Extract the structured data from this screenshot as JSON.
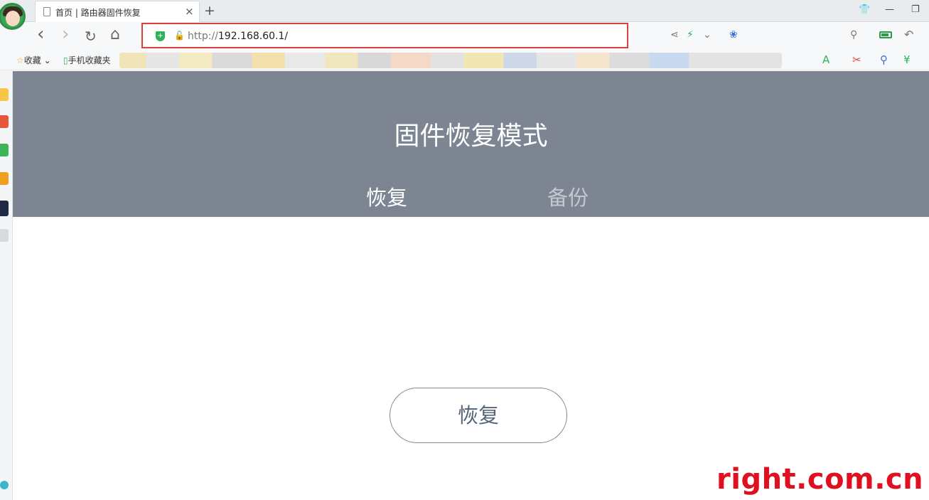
{
  "browser": {
    "tab": {
      "title": "首页 | 路由器固件恢复",
      "close": "×"
    },
    "new_tab": "+",
    "window": {
      "skin": "👕",
      "minimize": "—",
      "restore": "❐"
    },
    "nav": {
      "back": "‹",
      "forward": "›",
      "reload": "↻",
      "home": "⌂"
    },
    "address": {
      "protocol": "http://",
      "host": "192.168.60.1/"
    },
    "bookmarks": {
      "favorites": "收藏",
      "mobile_favorites": "手机收藏夹"
    },
    "accent": "#d9413b"
  },
  "page": {
    "title": "固件恢复模式",
    "tabs": [
      {
        "label": "恢复",
        "active": true
      },
      {
        "label": "备份",
        "active": false
      }
    ],
    "restore_button": "恢复"
  },
  "watermark": "right.com.cn",
  "colors": {
    "hero_bg": "#7c8591",
    "watermark": "#e01020",
    "shield": "#2eb35a"
  }
}
